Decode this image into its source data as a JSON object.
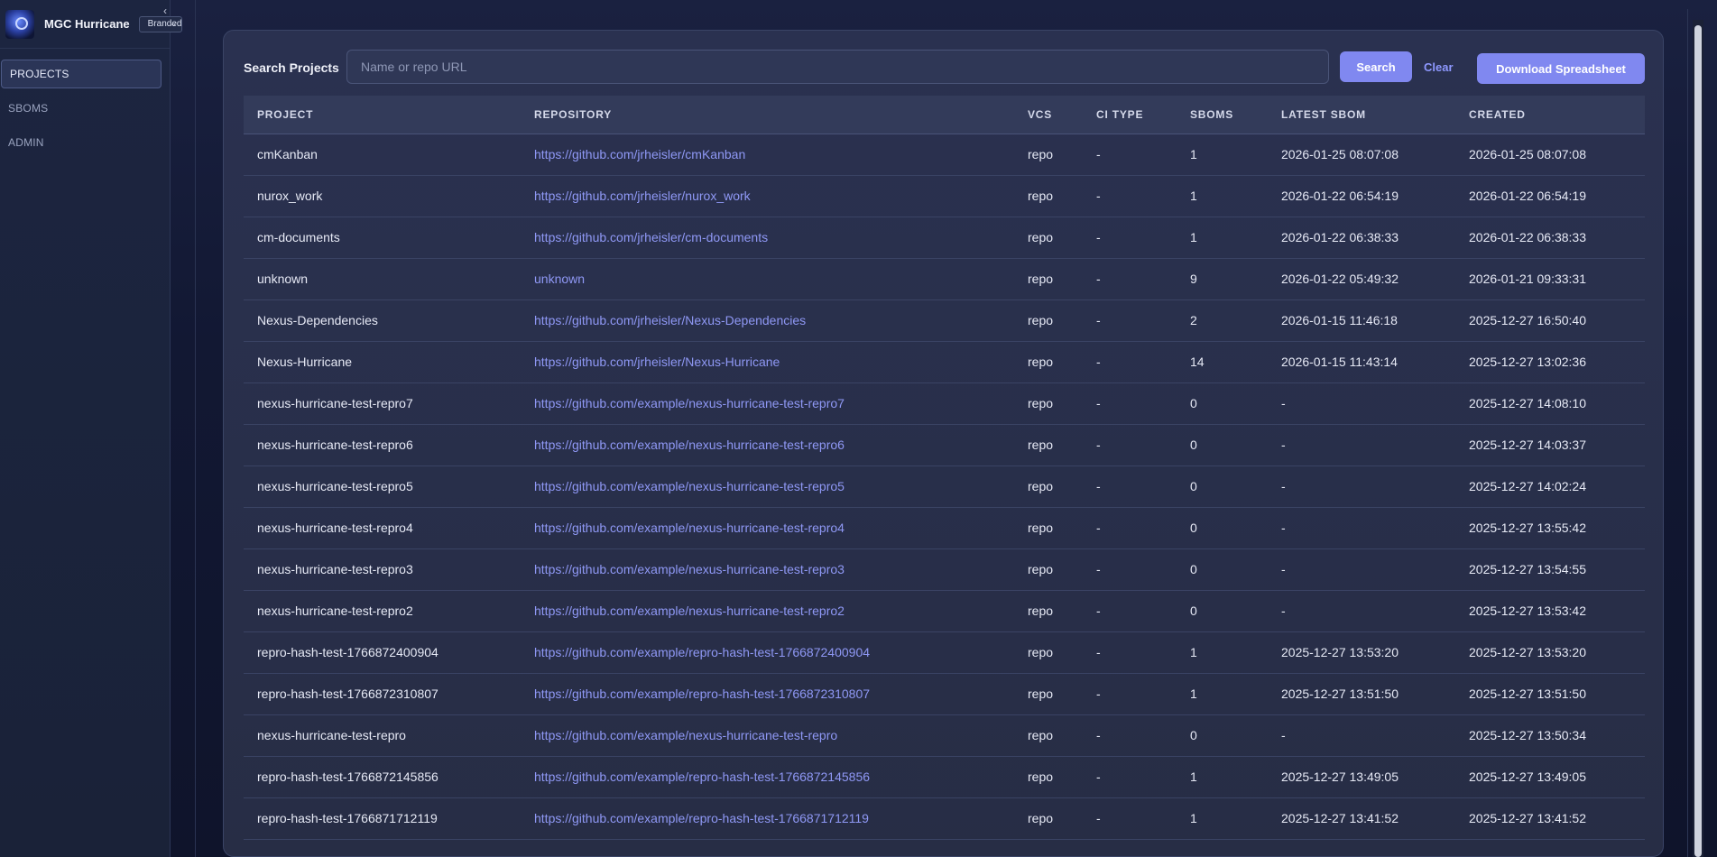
{
  "app": {
    "name": "MGC Hurricane",
    "theme_selected": "Branded"
  },
  "sidebar": {
    "items": [
      {
        "label": "PROJECTS",
        "active": true
      },
      {
        "label": "SBOMS",
        "active": false
      },
      {
        "label": "ADMIN",
        "active": false
      }
    ]
  },
  "search": {
    "label": "Search Projects",
    "placeholder": "Name or repo URL",
    "value": "",
    "search_button": "Search",
    "clear_link": "Clear",
    "download_button": "Download Spreadsheet"
  },
  "colors": {
    "accent": "#8088f0",
    "link": "#8f98f5"
  },
  "table": {
    "headers": [
      "PROJECT",
      "REPOSITORY",
      "VCS",
      "CI TYPE",
      "SBOMS",
      "LATEST SBOM",
      "CREATED"
    ],
    "rows": [
      {
        "project": "cmKanban",
        "repository": "https://github.com/jrheisler/cmKanban",
        "vcs": "repo",
        "ci_type": "-",
        "sboms": "1",
        "latest_sbom": "2026-01-25 08:07:08",
        "created": "2026-01-25 08:07:08"
      },
      {
        "project": "nurox_work",
        "repository": "https://github.com/jrheisler/nurox_work",
        "vcs": "repo",
        "ci_type": "-",
        "sboms": "1",
        "latest_sbom": "2026-01-22 06:54:19",
        "created": "2026-01-22 06:54:19"
      },
      {
        "project": "cm-documents",
        "repository": "https://github.com/jrheisler/cm-documents",
        "vcs": "repo",
        "ci_type": "-",
        "sboms": "1",
        "latest_sbom": "2026-01-22 06:38:33",
        "created": "2026-01-22 06:38:33"
      },
      {
        "project": "unknown",
        "repository": "unknown",
        "vcs": "repo",
        "ci_type": "-",
        "sboms": "9",
        "latest_sbom": "2026-01-22 05:49:32",
        "created": "2026-01-21 09:33:31"
      },
      {
        "project": "Nexus-Dependencies",
        "repository": "https://github.com/jrheisler/Nexus-Dependencies",
        "vcs": "repo",
        "ci_type": "-",
        "sboms": "2",
        "latest_sbom": "2026-01-15 11:46:18",
        "created": "2025-12-27 16:50:40"
      },
      {
        "project": "Nexus-Hurricane",
        "repository": "https://github.com/jrheisler/Nexus-Hurricane",
        "vcs": "repo",
        "ci_type": "-",
        "sboms": "14",
        "latest_sbom": "2026-01-15 11:43:14",
        "created": "2025-12-27 13:02:36"
      },
      {
        "project": "nexus-hurricane-test-repro7",
        "repository": "https://github.com/example/nexus-hurricane-test-repro7",
        "vcs": "repo",
        "ci_type": "-",
        "sboms": "0",
        "latest_sbom": "-",
        "created": "2025-12-27 14:08:10"
      },
      {
        "project": "nexus-hurricane-test-repro6",
        "repository": "https://github.com/example/nexus-hurricane-test-repro6",
        "vcs": "repo",
        "ci_type": "-",
        "sboms": "0",
        "latest_sbom": "-",
        "created": "2025-12-27 14:03:37"
      },
      {
        "project": "nexus-hurricane-test-repro5",
        "repository": "https://github.com/example/nexus-hurricane-test-repro5",
        "vcs": "repo",
        "ci_type": "-",
        "sboms": "0",
        "latest_sbom": "-",
        "created": "2025-12-27 14:02:24"
      },
      {
        "project": "nexus-hurricane-test-repro4",
        "repository": "https://github.com/example/nexus-hurricane-test-repro4",
        "vcs": "repo",
        "ci_type": "-",
        "sboms": "0",
        "latest_sbom": "-",
        "created": "2025-12-27 13:55:42"
      },
      {
        "project": "nexus-hurricane-test-repro3",
        "repository": "https://github.com/example/nexus-hurricane-test-repro3",
        "vcs": "repo",
        "ci_type": "-",
        "sboms": "0",
        "latest_sbom": "-",
        "created": "2025-12-27 13:54:55"
      },
      {
        "project": "nexus-hurricane-test-repro2",
        "repository": "https://github.com/example/nexus-hurricane-test-repro2",
        "vcs": "repo",
        "ci_type": "-",
        "sboms": "0",
        "latest_sbom": "-",
        "created": "2025-12-27 13:53:42"
      },
      {
        "project": "repro-hash-test-1766872400904",
        "repository": "https://github.com/example/repro-hash-test-1766872400904",
        "vcs": "repo",
        "ci_type": "-",
        "sboms": "1",
        "latest_sbom": "2025-12-27 13:53:20",
        "created": "2025-12-27 13:53:20"
      },
      {
        "project": "repro-hash-test-1766872310807",
        "repository": "https://github.com/example/repro-hash-test-1766872310807",
        "vcs": "repo",
        "ci_type": "-",
        "sboms": "1",
        "latest_sbom": "2025-12-27 13:51:50",
        "created": "2025-12-27 13:51:50"
      },
      {
        "project": "nexus-hurricane-test-repro",
        "repository": "https://github.com/example/nexus-hurricane-test-repro",
        "vcs": "repo",
        "ci_type": "-",
        "sboms": "0",
        "latest_sbom": "-",
        "created": "2025-12-27 13:50:34"
      },
      {
        "project": "repro-hash-test-1766872145856",
        "repository": "https://github.com/example/repro-hash-test-1766872145856",
        "vcs": "repo",
        "ci_type": "-",
        "sboms": "1",
        "latest_sbom": "2025-12-27 13:49:05",
        "created": "2025-12-27 13:49:05"
      },
      {
        "project": "repro-hash-test-1766871712119",
        "repository": "https://github.com/example/repro-hash-test-1766871712119",
        "vcs": "repo",
        "ci_type": "-",
        "sboms": "1",
        "latest_sbom": "2025-12-27 13:41:52",
        "created": "2025-12-27 13:41:52"
      }
    ]
  }
}
